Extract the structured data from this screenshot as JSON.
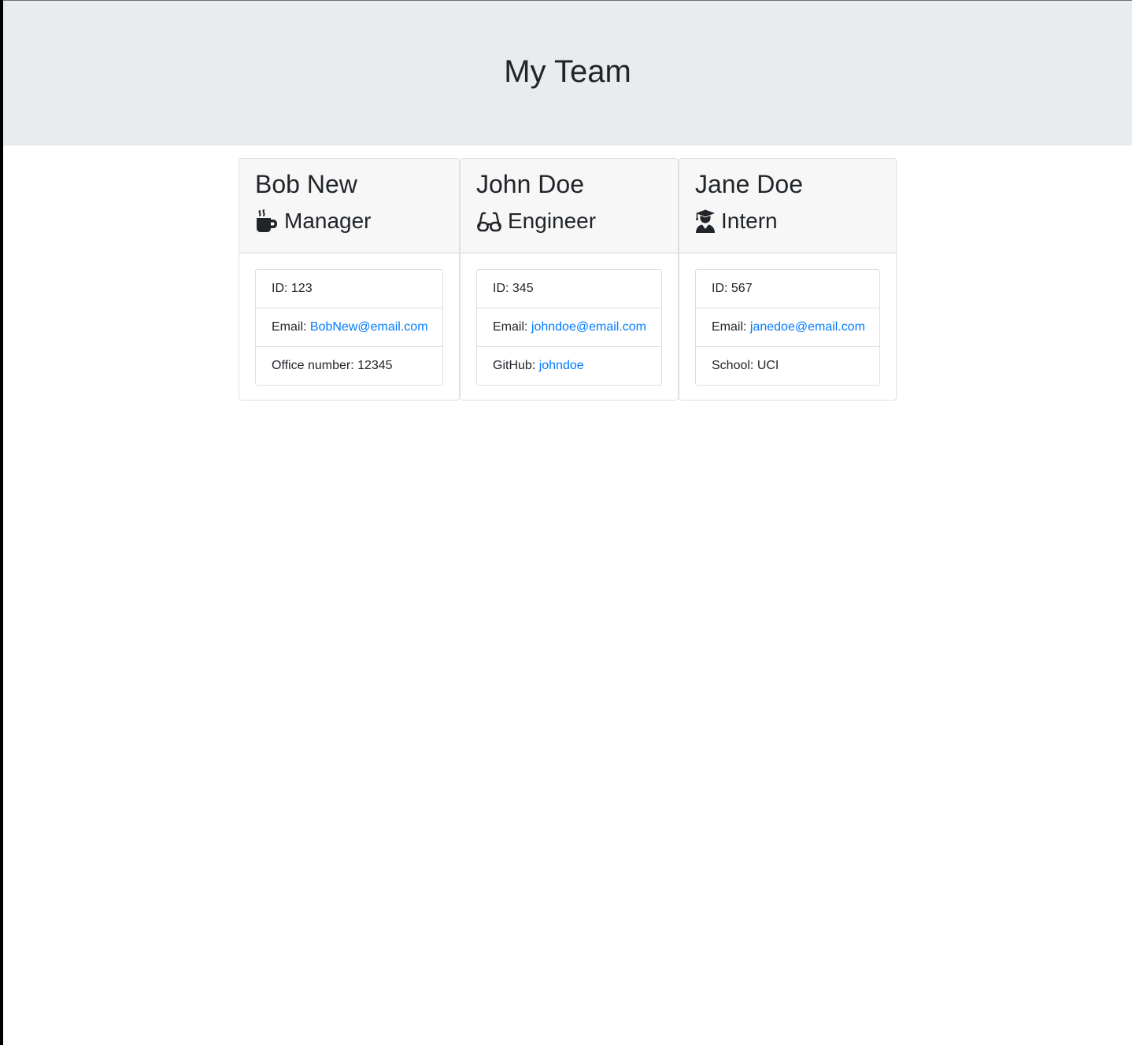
{
  "header": {
    "title": "My Team"
  },
  "cards": [
    {
      "name": "Bob New",
      "role": "Manager",
      "role_icon": "mug-hot-icon",
      "id_label": "ID: 123",
      "email_prefix": "Email: ",
      "email": "BobNew@email.com",
      "extra_prefix": "Office number: 12345"
    },
    {
      "name": "John Doe",
      "role": "Engineer",
      "role_icon": "glasses-icon",
      "id_label": "ID: 345",
      "email_prefix": "Email: ",
      "email": "johndoe@email.com",
      "extra_prefix": "GitHub: ",
      "extra_link": "johndoe"
    },
    {
      "name": "Jane Doe",
      "role": "Intern",
      "role_icon": "user-graduate-icon",
      "id_label": "ID: 567",
      "email_prefix": "Email: ",
      "email": "janedoe@email.com",
      "extra_prefix": "School: UCI"
    }
  ],
  "colors": {
    "header_bg": "#e9ecef",
    "card_header_bg": "#f7f7f7",
    "link": "#007bff",
    "text": "#212529"
  }
}
